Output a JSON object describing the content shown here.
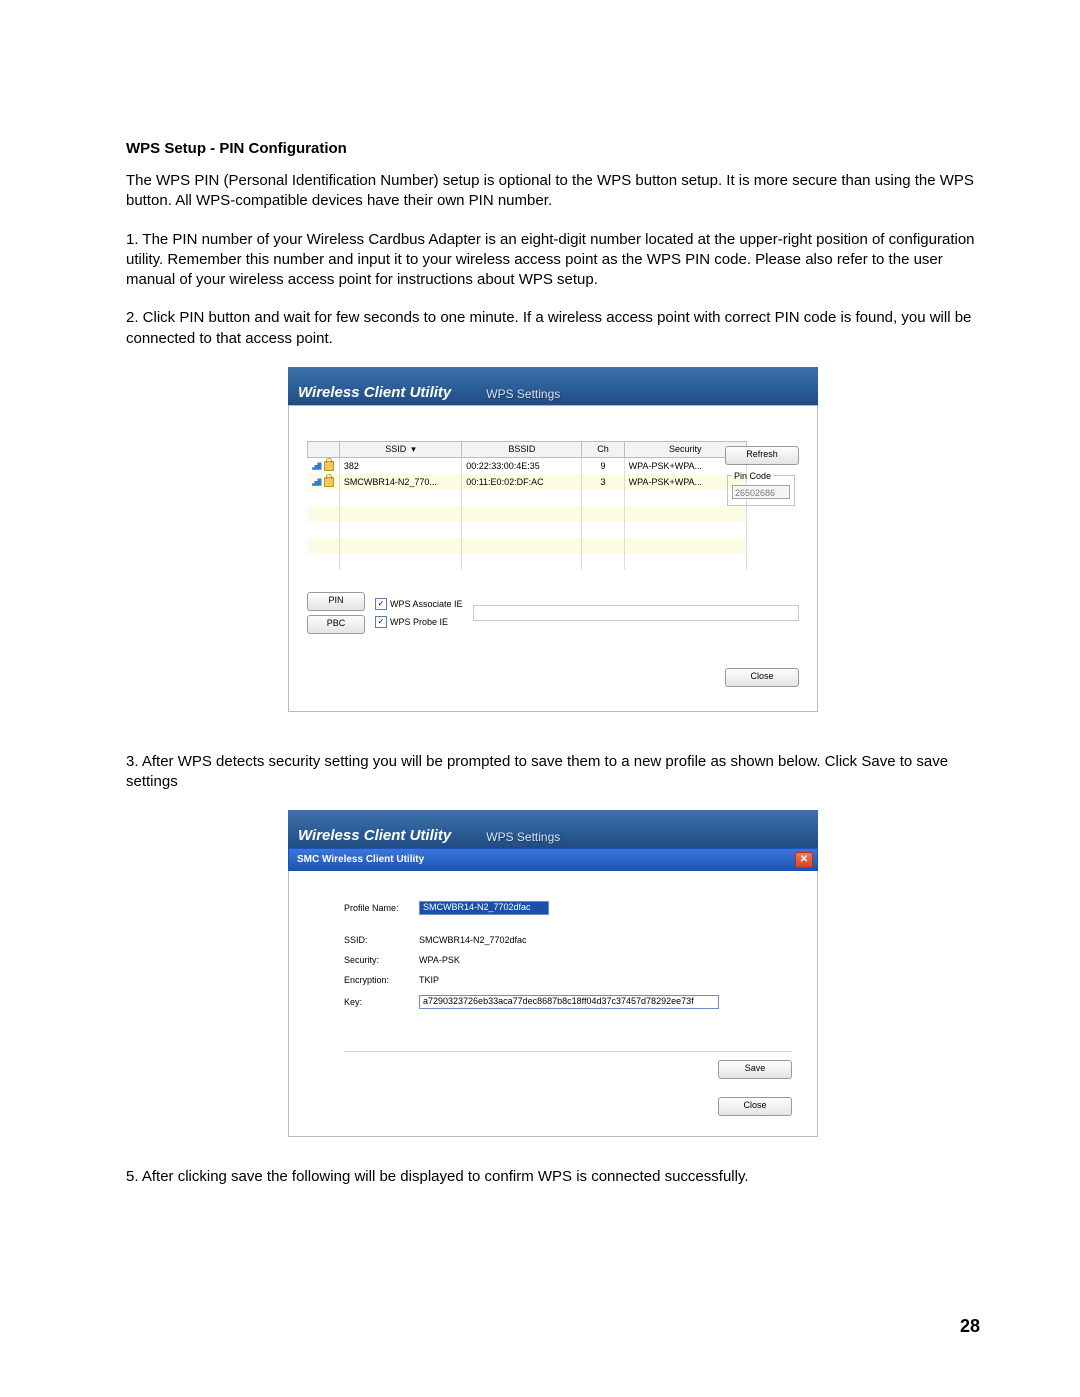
{
  "heading": "WPS Setup - PIN Configuration",
  "paragraphs": {
    "p1": "The WPS PIN (Personal Identification Number) setup is optional to the WPS button setup. It is more secure than using the WPS button. All WPS-compatible devices have their own PIN number.",
    "p2": "1. The PIN number of your Wireless Cardbus Adapter is an eight-digit number located at the upper-right position of configuration utility. Remember this number and input it to your wireless access point as the WPS PIN code. Please also refer to the user manual of your wireless access point for instructions about WPS setup.",
    "p3": "2. Click PIN button and wait for few seconds to one minute. If a wireless access point with correct PIN code is found, you will be connected to that access point.",
    "p4": "3. After WPS detects security setting you will be prompted to save them to a new profile as shown below. Click Save to save settings",
    "p5": "5. After clicking save the following will be displayed to confirm WPS is connected successfully."
  },
  "page_number": "28",
  "shot_app_title": "Wireless Client Utility",
  "shot_subtitle": "WPS Settings",
  "shot1": {
    "headers": {
      "ssid": "SSID",
      "bssid": "BSSID",
      "ch": "Ch",
      "security": "Security"
    },
    "rows": [
      {
        "ssid": "382",
        "bssid": "00:22:33:00:4E:35",
        "ch": "9",
        "sec": "WPA-PSK+WPA..."
      },
      {
        "ssid": "SMCWBR14-N2_770...",
        "bssid": "00:11:E0:02:DF:AC",
        "ch": "3",
        "sec": "WPA-PSK+WPA..."
      }
    ],
    "refresh": "Refresh",
    "pin_legend": "Pin Code",
    "pin_code": "26502686",
    "pin_btn": "PIN",
    "pbc_btn": "PBC",
    "cb_assoc": "WPS Associate IE",
    "cb_probe": "WPS Probe IE",
    "close": "Close"
  },
  "shot2": {
    "dialog_title": "SMC Wireless Client Utility",
    "labels": {
      "profile": "Profile Name:",
      "ssid": "SSID:",
      "security": "Security:",
      "encryption": "Encryption:",
      "key": "Key:"
    },
    "values": {
      "profile": "SMCWBR14-N2_7702dfac",
      "ssid": "SMCWBR14-N2_7702dfac",
      "security": "WPA-PSK",
      "encryption": "TKIP",
      "key": "a7290323726eb33aca77dec8687b8c18ff04d37c37457d78292ee73f"
    },
    "save": "Save",
    "close": "Close"
  }
}
